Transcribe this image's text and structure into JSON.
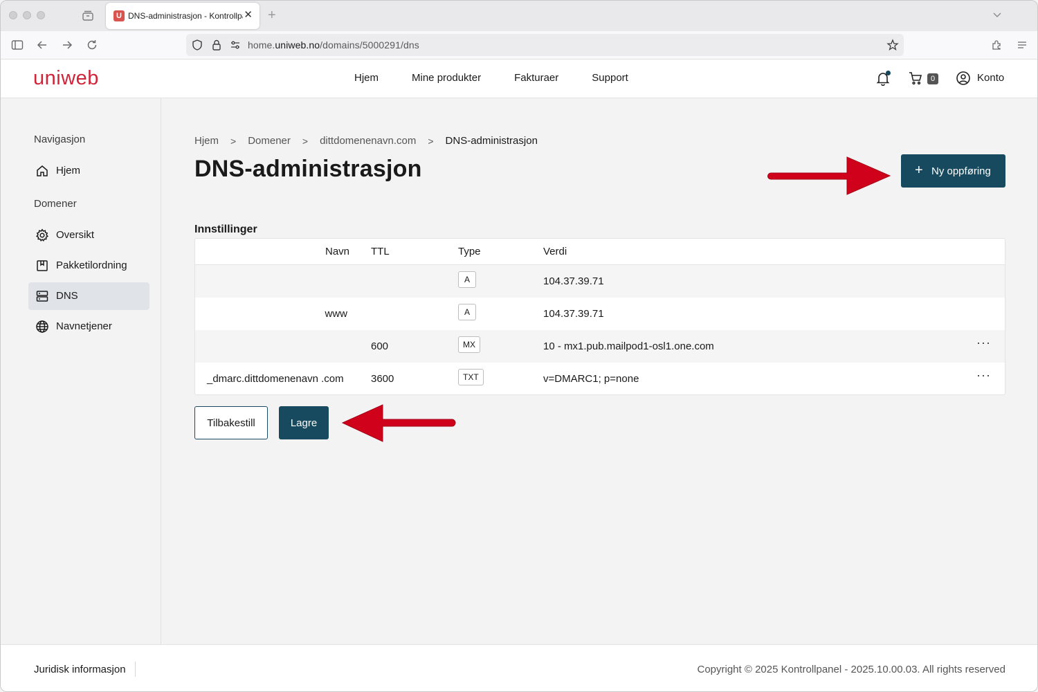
{
  "browser": {
    "tab_title": "DNS-administrasjon - Kontrollpanel",
    "favicon_letter": "U",
    "url_prefix": "home.",
    "url_domain": "uniweb.no",
    "url_path": "/domains/5000291/dns"
  },
  "header": {
    "logo": "uniweb",
    "nav": [
      "Hjem",
      "Mine produkter",
      "Fakturaer",
      "Support"
    ],
    "cart_count": "0",
    "account_label": "Konto"
  },
  "sidebar": {
    "heading_nav": "Navigasjon",
    "home_label": "Hjem",
    "heading_domains": "Domener",
    "items": [
      {
        "label": "Oversikt",
        "icon": "gear-icon"
      },
      {
        "label": "Pakketilordning",
        "icon": "package-icon"
      },
      {
        "label": "DNS",
        "icon": "server-icon",
        "active": true
      },
      {
        "label": "Navnetjener",
        "icon": "globe-icon"
      }
    ]
  },
  "main": {
    "breadcrumb": [
      "Hjem",
      "Domener",
      "dittdomenenavn.com",
      "DNS-administrasjon"
    ],
    "title": "DNS-administrasjon",
    "new_button": "Ny oppføring",
    "section_title": "Innstillinger",
    "columns": [
      "Navn",
      "TTL",
      "Type",
      "Verdi"
    ],
    "rows": [
      {
        "name": "",
        "ttl": "",
        "type": "A",
        "value": "104.37.39.71",
        "menu": false
      },
      {
        "name": "www",
        "ttl": "",
        "type": "A",
        "value": "104.37.39.71",
        "menu": false
      },
      {
        "name": "",
        "ttl": "600",
        "type": "MX",
        "value": "10 - mx1.pub.mailpod1-osl1.one.com",
        "menu": true
      },
      {
        "name": "_dmarc.dittdomenenavn .com",
        "ttl": "3600",
        "type": "TXT",
        "value": "v=DMARC1; p=none",
        "menu": true
      }
    ],
    "row_menu_glyph": "···",
    "reset_button": "Tilbakestill",
    "save_button": "Lagre"
  },
  "footer": {
    "legal": "Juridisk informasjon",
    "copyright": "Copyright © 2025 Kontrollpanel - 2025.10.00.03. All rights reserved"
  },
  "colors": {
    "brand_red": "#d0243a",
    "primary": "#174a5f",
    "annotation_red": "#d0021b"
  }
}
